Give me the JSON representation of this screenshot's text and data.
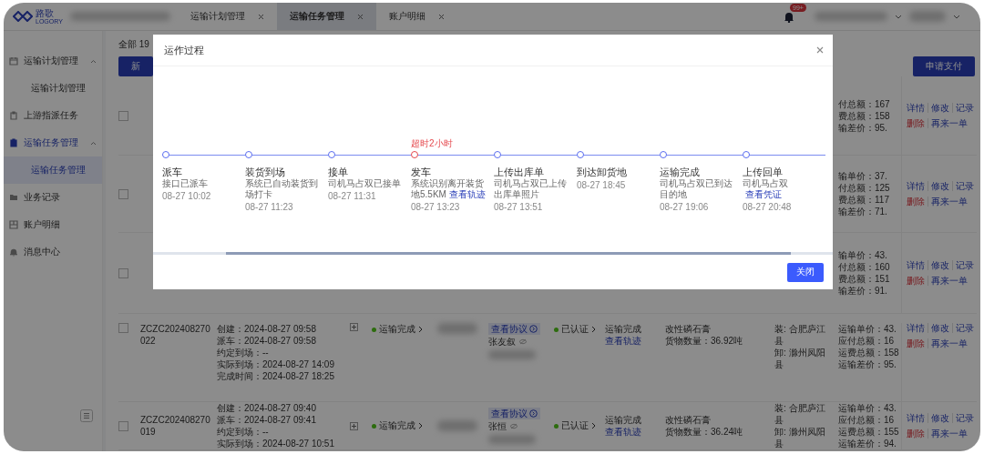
{
  "app": {
    "logo": "路歌",
    "logo_sub": "LOGORY"
  },
  "tabs": [
    {
      "label": "运输计划管理",
      "selected": false
    },
    {
      "label": "运输任务管理",
      "selected": true
    },
    {
      "label": "账户明细",
      "selected": false
    }
  ],
  "notifications": {
    "badge": "99+"
  },
  "sidebar": {
    "items": [
      {
        "label": "运输计划管理",
        "selected": false,
        "expanded": true,
        "children": [
          {
            "label": "运输计划管理",
            "selected": false
          }
        ]
      },
      {
        "label": "上游指派任务",
        "selected": false,
        "expanded": false
      },
      {
        "label": "运输任务管理",
        "selected": true,
        "expanded": true,
        "children": [
          {
            "label": "运输任务管理",
            "selected": true
          }
        ]
      },
      {
        "label": "业务记录",
        "selected": false,
        "expanded": false
      },
      {
        "label": "账户明细",
        "selected": false,
        "expanded": false
      },
      {
        "label": "消息中心",
        "selected": false,
        "expanded": false
      }
    ]
  },
  "toolbar": {
    "total": "全部 19",
    "new_button": "新",
    "pay_button": "申请支付"
  },
  "rows": [
    {
      "checked": false,
      "prices": [
        "付总额：167",
        "费总额：158",
        "输差价：95."
      ],
      "actions": [
        [
          {
            "label": "详情",
            "kind": "link"
          },
          {
            "label": "修改",
            "kind": "link"
          },
          {
            "label": "记录",
            "kind": "link"
          }
        ],
        [
          {
            "label": "删除",
            "kind": "danger"
          },
          {
            "label": "再来一单",
            "kind": "link"
          }
        ]
      ]
    },
    {
      "checked": false,
      "prices": [
        "输单价：37.",
        "付总额：125",
        "费总额：117",
        "输差价：71."
      ],
      "actions": [
        [
          {
            "label": "详情",
            "kind": "link"
          },
          {
            "label": "修改",
            "kind": "link"
          },
          {
            "label": "记录",
            "kind": "link"
          }
        ],
        [
          {
            "label": "删除",
            "kind": "danger"
          },
          {
            "label": "再来一单",
            "kind": "link"
          }
        ]
      ]
    },
    {
      "checked": false,
      "prices": [
        "输单价：43.",
        "付总额：160",
        "费总额：151",
        "输差价：91."
      ],
      "actions": [
        [
          {
            "label": "详情",
            "kind": "link"
          },
          {
            "label": "修改",
            "kind": "link"
          },
          {
            "label": "记录",
            "kind": "link"
          }
        ],
        [
          {
            "label": "删除",
            "kind": "danger"
          },
          {
            "label": "再来一单",
            "kind": "link"
          }
        ]
      ]
    },
    {
      "checked": false,
      "order_id": "ZCZC202408270022",
      "times": [
        "创建：2024-08-27 09:58",
        "派车：2024-08-27 09:58",
        "约定到场：--",
        "实际到场：2024-08-27 14:09",
        "完成时间：2024-08-27 18:25"
      ],
      "status": {
        "label": "运输完成",
        "color": "#2d6c0e"
      },
      "agreement": "查看协议",
      "driver": "张友叙",
      "cert": {
        "label": "已认证",
        "color": "#2d6c0e"
      },
      "progress": "运输完成",
      "track_link": "查看轨迹",
      "goods": "改性磷石膏",
      "quantity": "货物数量：36.92吨",
      "load": "装: 合肥庐江县",
      "unload": "卸: 滁州凤阳县",
      "prices": [
        "运输单价：43.",
        "应付总额：16",
        "运费总额：158",
        "运输差价：95."
      ],
      "actions": [
        [
          {
            "label": "详情",
            "kind": "link"
          },
          {
            "label": "修改",
            "kind": "link"
          },
          {
            "label": "记录",
            "kind": "link"
          }
        ],
        [
          {
            "label": "删除",
            "kind": "danger"
          },
          {
            "label": "再来一单",
            "kind": "link"
          }
        ]
      ]
    },
    {
      "checked": false,
      "order_id": "ZCZC202408270019",
      "times": [
        "创建：2024-08-27 09:40",
        "派车：2024-08-27 09:41",
        "约定到场：--",
        "实际到场：2024-08-27 10:51"
      ],
      "status": {
        "label": "运输完成",
        "color": "#2d6c0e"
      },
      "agreement": "查看协议",
      "driver": "张恒",
      "cert": {
        "label": "已认证",
        "color": "#2d6c0e"
      },
      "progress": "运输完成",
      "track_link": "查看轨迹",
      "goods": "改性磷石膏",
      "quantity": "货物数量：36.24吨",
      "load": "装: 合肥庐江县",
      "unload": "卸: 滁州凤阳县",
      "prices": [
        "运输单价：43.",
        "应付总额：16",
        "运费总额：155",
        "运输差价：94."
      ],
      "actions": [
        [
          {
            "label": "详情",
            "kind": "link"
          },
          {
            "label": "修改",
            "kind": "link"
          },
          {
            "label": "记录",
            "kind": "link"
          }
        ],
        [
          {
            "label": "删除",
            "kind": "danger"
          },
          {
            "label": "再来一单",
            "kind": "link"
          }
        ]
      ]
    }
  ],
  "dialog": {
    "title": "运作过程",
    "close_button": "关闭",
    "steps": [
      {
        "title": "派车",
        "desc": "接口已派车",
        "time": "08-27 10:02",
        "overdue": false
      },
      {
        "title": "装货到场",
        "desc": "系统已自动装货到场打卡",
        "time": "08-27 11:23",
        "overdue": false
      },
      {
        "title": "接单",
        "desc": "司机马占双已接单",
        "time": "08-27 11:31",
        "overdue": false
      },
      {
        "title": "发车",
        "desc": "系统识别离开装货地5.5KM",
        "link": "查看轨迹",
        "time": "08-27 13:23",
        "overdue": true,
        "warning": "超时2小时"
      },
      {
        "title": "上传出库单",
        "desc": "司机马占双已上传出库单照片",
        "time": "08-27 13:51",
        "overdue": false
      },
      {
        "title": "到达卸货地",
        "time": "08-27 18:45",
        "overdue": false
      },
      {
        "title": "运输完成",
        "desc": "司机马占双已到达目的地",
        "time": "08-27 19:06",
        "overdue": false
      },
      {
        "title": "上传回单",
        "desc": "司机马占双",
        "link": "查看凭证",
        "time": "08-27 20:48",
        "overdue": false
      }
    ]
  }
}
